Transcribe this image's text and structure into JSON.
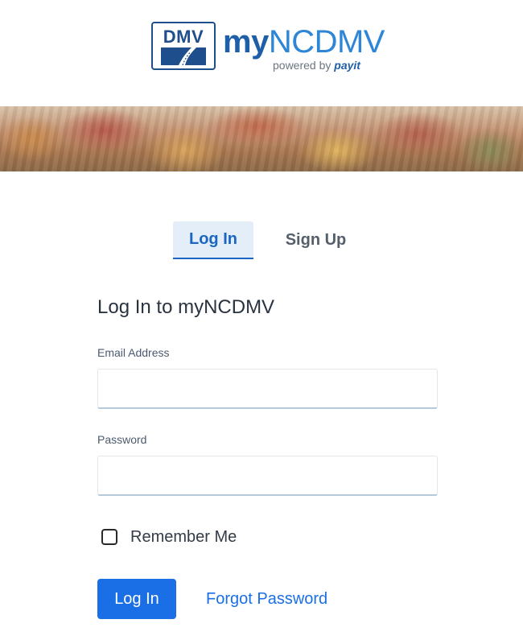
{
  "header": {
    "badge_text": "DMV",
    "brand_my": "my",
    "brand_ncdmv": "NCDMV",
    "powered_by": "powered by ",
    "powered_brand": "payit",
    "colors": {
      "brand_blue": "#1f5fa8",
      "accent_blue": "#2f86d6"
    }
  },
  "banner": {
    "description_icon": "autumn-hills-image"
  },
  "tabs": [
    {
      "label": "Log In",
      "active": true
    },
    {
      "label": "Sign Up",
      "active": false
    }
  ],
  "form": {
    "title": "Log In to myNCDMV",
    "email": {
      "label": "Email Address",
      "value": "",
      "placeholder": ""
    },
    "password": {
      "label": "Password",
      "value": "",
      "placeholder": ""
    },
    "remember": {
      "label": "Remember Me",
      "checked": false
    },
    "submit_label": "Log In",
    "forgot_label": "Forgot Password"
  },
  "colors": {
    "primary": "#1a6fe6",
    "tab_active_bg": "#e4eef9"
  }
}
